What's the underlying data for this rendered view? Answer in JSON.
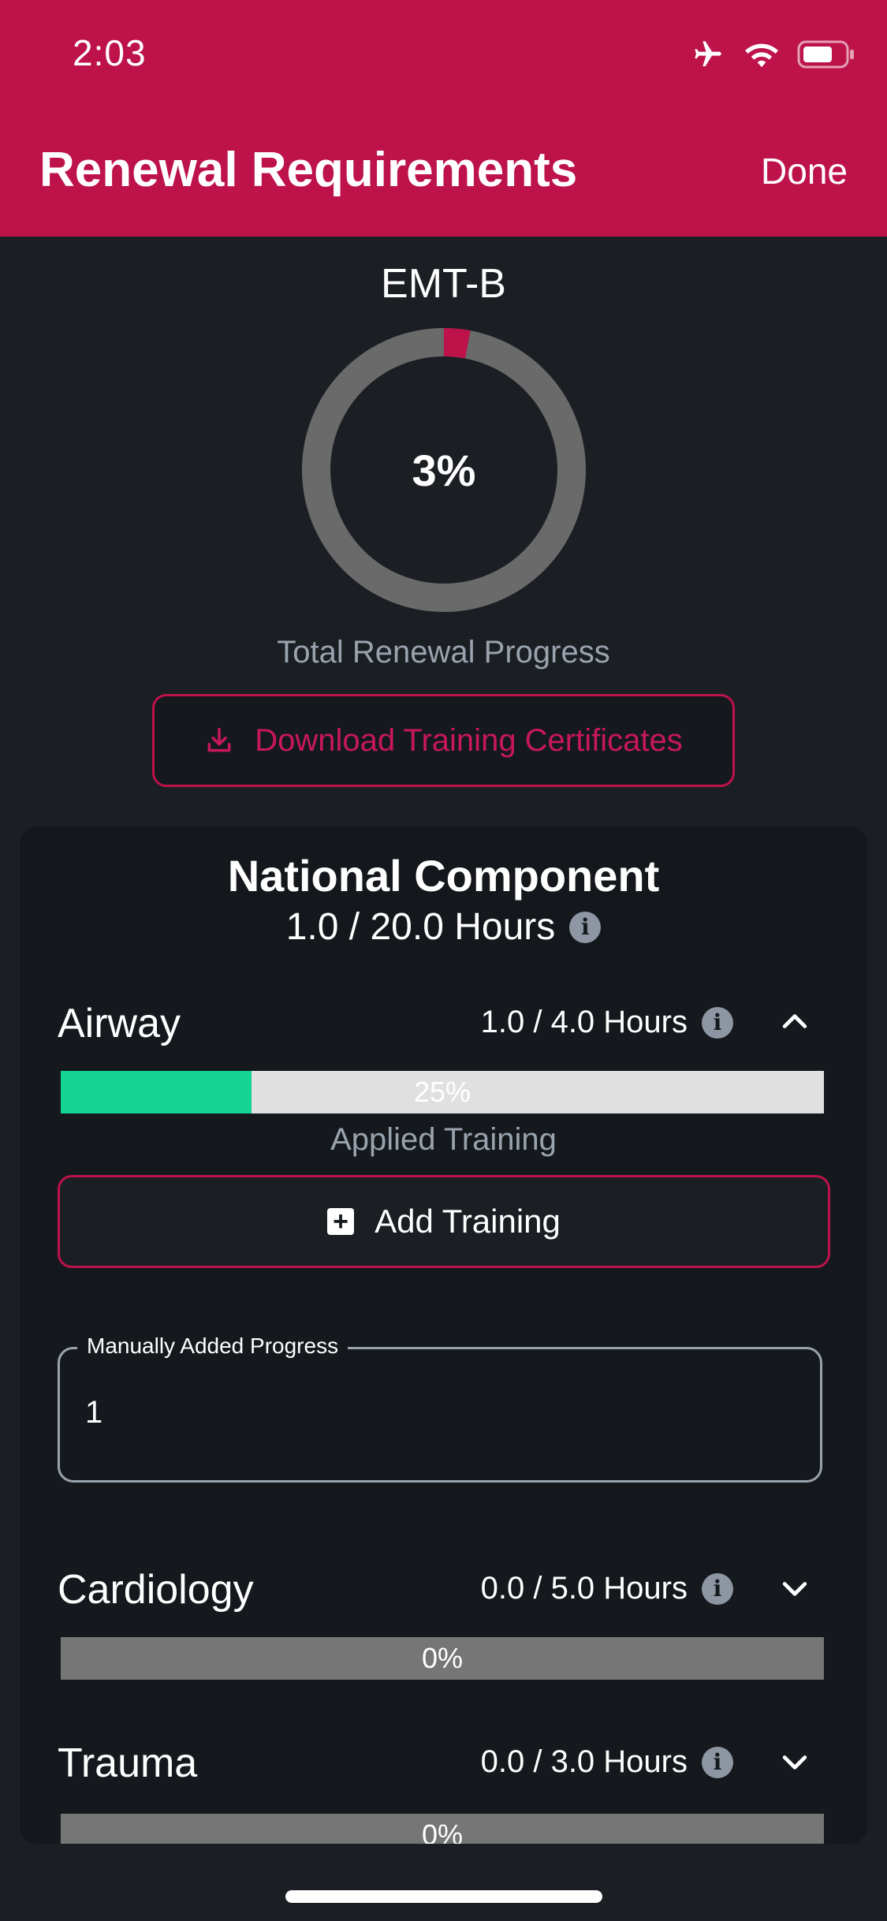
{
  "status_bar": {
    "time": "2:03",
    "icons": [
      "airplane-icon",
      "wifi-icon",
      "battery-icon"
    ]
  },
  "nav": {
    "title": "Renewal Requirements",
    "done_label": "Done"
  },
  "summary": {
    "certification": "EMT-B",
    "total_percent": 3,
    "total_percent_label": "3%",
    "total_label": "Total Renewal Progress",
    "download_label": "Download Training Certificates"
  },
  "component": {
    "title": "National Component",
    "hours": "1.0 / 20.0 Hours"
  },
  "sections": [
    {
      "name": "Airway",
      "hours": "1.0  /  4.0 Hours",
      "progress": 25,
      "progress_label": "25%",
      "expanded": true,
      "applied_label": "Applied Training",
      "add_label": "Add Training",
      "manual_field_label": "Manually Added Progress",
      "manual_field_value": "1"
    },
    {
      "name": "Cardiology",
      "hours": "0.0  /  5.0 Hours",
      "progress": 0,
      "progress_label": "0%",
      "expanded": false
    },
    {
      "name": "Trauma",
      "hours": "0.0  /  3.0 Hours",
      "progress": 0,
      "progress_label": "0%",
      "expanded": false
    }
  ],
  "colors": {
    "accent": "#bd134a",
    "progress_fill": "#15d393",
    "background": "#1b1f24"
  }
}
